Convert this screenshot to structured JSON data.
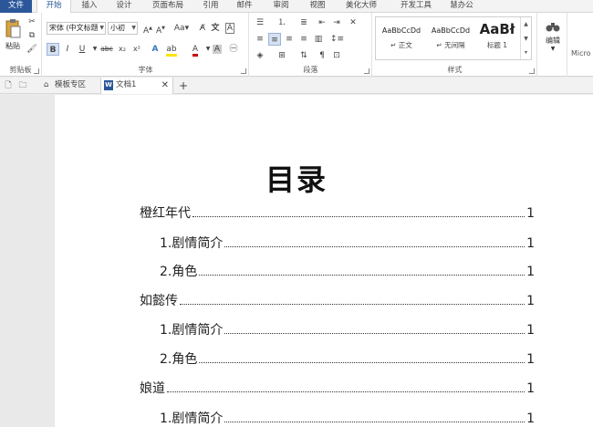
{
  "ribbon_tabs": [
    "文件",
    "开始",
    "插入",
    "设计",
    "页面布局",
    "引用",
    "邮件",
    "审阅",
    "视图",
    "美化大师",
    "开发工具",
    "慧办公"
  ],
  "clipboard": {
    "paste_label": "粘贴",
    "group_label": "剪贴板"
  },
  "font": {
    "name_value": "宋体 (中文标题",
    "size_value": "小初",
    "group_label": "字体"
  },
  "paragraph": {
    "group_label": "段落"
  },
  "styles": {
    "group_label": "样式",
    "items": [
      {
        "preview": "AaBbCcDd",
        "name": "↵ 正文"
      },
      {
        "preview": "AaBbCcDd",
        "name": "↵ 无间隔"
      },
      {
        "preview": "AaBł",
        "name": "标题 1"
      }
    ]
  },
  "editing": {
    "label": "编辑"
  },
  "cutoff_text": "Micro",
  "doc_tabs": [
    {
      "label": "模板专区"
    },
    {
      "label": "文档1"
    }
  ],
  "document": {
    "title": "目录",
    "entries": [
      {
        "text": "橙红年代",
        "page": "1",
        "level": 1
      },
      {
        "text": "1.剧情简介",
        "page": "1",
        "level": 2
      },
      {
        "text": "2.角色",
        "page": "1",
        "level": 2
      },
      {
        "text": "如懿传",
        "page": "1",
        "level": 1
      },
      {
        "text": "1.剧情简介",
        "page": "1",
        "level": 2
      },
      {
        "text": "2.角色",
        "page": "1",
        "level": 2
      },
      {
        "text": "娘道",
        "page": "1",
        "level": 1
      },
      {
        "text": "1.剧情简介",
        "page": "1",
        "level": 2
      }
    ]
  }
}
